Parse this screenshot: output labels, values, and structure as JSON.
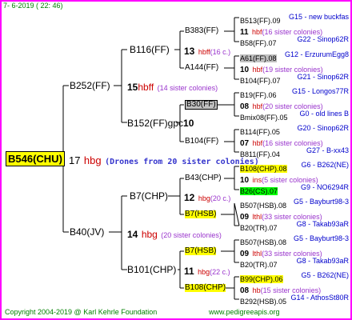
{
  "date": "7-  6-2019 ( 22: 46)",
  "footer": {
    "copyright": "Copyright 2004-2019 @ Karl Kehrle Foundation",
    "url": "www.pedigreeapis.org"
  },
  "root": {
    "name": "B546(CHU)",
    "num": "17",
    "hb": "hbg",
    "note": "(Drones from 20 sister colonies)"
  },
  "gen1": [
    {
      "name": "B252(FF)",
      "num": "15",
      "hb": "hbff",
      "note": "(14 sister colonies)"
    },
    {
      "name": "B40(JV)",
      "num": "14",
      "hb": "hbg",
      "note": "(20 sister colonies)"
    }
  ],
  "gen2": [
    {
      "name": "B116(FF)",
      "num": "13",
      "hb": "hbff",
      "note": "(16 c.)"
    },
    {
      "name": "B152(FF)gpc",
      "num": "10",
      "hb": "",
      "note": ""
    },
    {
      "name": "B7(CHP)",
      "num": "12",
      "hb": "hbg",
      "note": "(20 c.)"
    },
    {
      "name": "B101(CHP)",
      "num": "11",
      "hb": "hbg",
      "note": "(22 c.)"
    }
  ],
  "gen3": [
    {
      "name": "B383(FF)"
    },
    {
      "name": "A144(FF)"
    },
    {
      "name": "B30(FF)"
    },
    {
      "name": "B104(FF)"
    },
    {
      "name": "B43(CHP)"
    },
    {
      "name": "B7(HSB)"
    },
    {
      "name": "B7(HSB)"
    },
    {
      "name": "B108(CHP)"
    }
  ],
  "gen4": [
    {
      "queen": "B513(FF).09",
      "link": "G15 - new buckfas",
      "num": "11",
      "hb": "hbf",
      "note": "(16 sister colonies)",
      "father": "B58(FF).07",
      "flink": "G22 - Sinop62R"
    },
    {
      "queen": "A61(FF).08",
      "link": "G12 - ErzurumEgg8",
      "num": "10",
      "hb": "hbf",
      "note": "(19 sister colonies)",
      "father": "B104(FF).07",
      "flink": "G21 - Sinop62R"
    },
    {
      "queen": "B19(FF).06",
      "link": "G15 - Longos77R",
      "num": "08",
      "hb": "hbf",
      "note": "(20 sister colonies)",
      "father": "Bmix08(FF).05",
      "flink": "G0 - old lines B"
    },
    {
      "queen": "B114(FF).05",
      "link": "G20 - Sinop62R",
      "num": "07",
      "hb": "hbf",
      "note": "(16 sister colonies)",
      "father": "B811(FF).04",
      "flink": "G27 - B-xx43"
    },
    {
      "queen": "B108(CHP).08",
      "link": "G6 - B262(NE)",
      "num": "10",
      "hb": "ins",
      "note": "(5 sister colonies)",
      "father": "B26(CS).07",
      "flink": "G9 - NO6294R"
    },
    {
      "queen": "B507(HSB).08",
      "link": "G5 - Bayburt98-3",
      "num": "09",
      "hb": "lthl",
      "note": "(33 sister colonies)",
      "father": "B20(TR).07",
      "flink": "G8 - Takab93aR"
    },
    {
      "queen": "B507(HSB).08",
      "link": "G5 - Bayburt98-3",
      "num": "09",
      "hb": "lthl",
      "note": "(33 sister colonies)",
      "father": "B20(TR).07",
      "flink": "G8 - Takab93aR"
    },
    {
      "queen": "B99(CHP).06",
      "link": "G5 - B262(NE)",
      "num": "08",
      "hb": "hb",
      "note": "(15 sister colonies)",
      "father": "B292(HSB).05",
      "flink": "G14 - AthosSt80R"
    }
  ]
}
